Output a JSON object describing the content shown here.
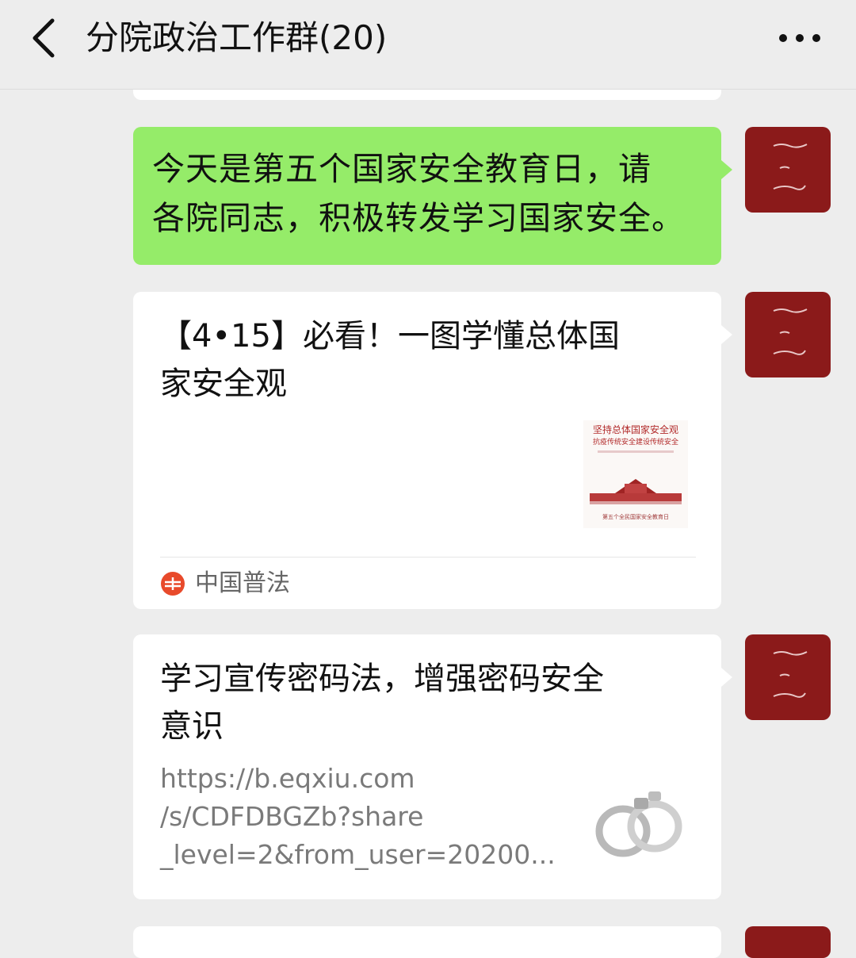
{
  "header": {
    "title": "分院政治工作群(20)",
    "back_icon": "chevron-left-icon",
    "more_icon": "more-dots-icon"
  },
  "messages": [
    {
      "type": "text",
      "text_line1": "今天是第五个国家安全教育日，请",
      "text_line2": "各院同志，积极转发学习国家安全。"
    },
    {
      "type": "link-card",
      "title_line1": "【4•15】必看！一图学懂总体国",
      "title_line2": "家安全观",
      "thumb_line1": "坚持总体国家安全观",
      "thumb_line2": "抗疫传统安全建设传统安全",
      "thumb_footer": "第五个全民国家安全教育日",
      "source": "中国普法"
    },
    {
      "type": "link-card",
      "title_line1": "学习宣传密码法，增强密码安全",
      "title_line2": "意识",
      "desc_line1": "https://b.eqxiu.com",
      "desc_line2": "/s/CDFDBGZb?share",
      "desc_line3": "_level=2&from_user=20200..."
    }
  ],
  "colors": {
    "background": "#ededed",
    "own_bubble": "#95ec69",
    "avatar": "#8b1a1a"
  }
}
